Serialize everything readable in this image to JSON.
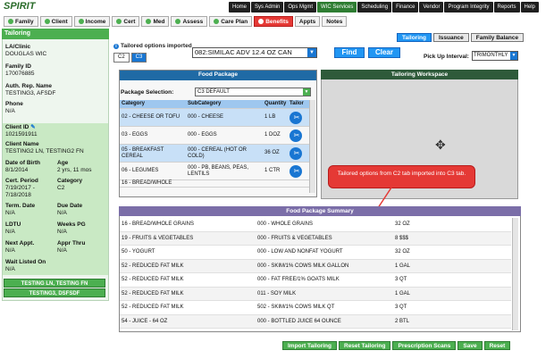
{
  "app": {
    "logo_text": "SPIRIT"
  },
  "top_menu": [
    "Home",
    "Sys Admin",
    "Ops Mgmt",
    "WIC Services",
    "Scheduling",
    "Finance",
    "Vendor",
    "Program Integrity",
    "Reports",
    "Help"
  ],
  "top_menu_active": "WIC Services",
  "module_tabs": [
    "Family",
    "Client",
    "Income",
    "Cert",
    "Med",
    "Assess",
    "Care Plan",
    "Benefits",
    "Appts",
    "Notes"
  ],
  "sidebar": {
    "header": "Tailoring",
    "la_clinic_label": "LA/Clinic",
    "la_clinic": "DOUGLAS WIC",
    "family_id_label": "Family ID",
    "family_id": "170076885",
    "auth_rep_label": "Auth. Rep. Name",
    "auth_rep": "TESTING3, AFSDF",
    "phone_label": "Phone",
    "phone": "N/A",
    "client_id_label": "Client ID",
    "client_id": "1021591911",
    "client_name_label": "Client Name",
    "client_name": "TESTING2 LN, TESTING2 FN",
    "dob_label": "Date of Birth",
    "dob": "8/1/2014",
    "age_label": "Age",
    "age": "2 yrs, 11 mos",
    "cert_period_label": "Cert. Period",
    "cert_period": "7/19/2017 - 7/18/2018",
    "category_label": "Category",
    "category": "C2",
    "term_date_label": "Term. Date",
    "term_date": "N/A",
    "due_date_label": "Due Date",
    "due_date": "N/A",
    "ldtu_label": "LDTU",
    "ldtu": "N/A",
    "weeks_pg_label": "Weeks PG",
    "weeks_pg": "N/A",
    "next_appt_label": "Next Appt.",
    "next_appt": "N/A",
    "appr_thru_label": "Appr Thru",
    "appr_thru": "N/A",
    "wait_listed_label": "Wait Listed On",
    "wait_listed": "N/A",
    "btn1": "TESTING LN, TESTING FN",
    "btn2": "TESTING3, DSFSDF"
  },
  "right_tabs": [
    "Tailoring",
    "Issuance",
    "Family Balance"
  ],
  "tailoring": {
    "info_text": "Tailored options imported",
    "c_tabs": [
      "C2",
      "C3"
    ],
    "search_value": "082:SIMILAC ADV 12.4 OZ CAN",
    "find_label": "Find",
    "clear_label": "Clear",
    "pickup_label": "Pick Up Interval:",
    "pickup_value": "TRIMONTHLY"
  },
  "food_package": {
    "title": "Food Package",
    "selection_label": "Package Selection:",
    "selection_value": "C3 DEFAULT",
    "columns": [
      "Category",
      "SubCategory",
      "Quantity",
      "Tailor"
    ],
    "rows": [
      [
        "02 - CHEESE OR TOFU",
        "000 - CHEESE",
        "1 LB"
      ],
      [
        "03 - EGGS",
        "000 - EGGS",
        "1 DOZ"
      ],
      [
        "05 - BREAKFAST CEREAL",
        "000 - CEREAL (HOT OR COLD)",
        "36 OZ"
      ],
      [
        "06 - LEGUMES",
        "000 - PB, BEANS, PEAS, LENTILS",
        "1 CTR"
      ],
      [
        "16 - BREAD/WHOLE",
        "",
        ""
      ]
    ]
  },
  "workspace": {
    "title": "Tailoring Workspace"
  },
  "callout": {
    "text": "Tailored options from C2 tab imported into C3 tab."
  },
  "summary": {
    "title": "Food Package Summary",
    "rows": [
      [
        "16 - BREAD/WHOLE GRAINS",
        "000 - WHOLE GRAINS",
        "32 OZ"
      ],
      [
        "19 - FRUITS & VEGETABLES",
        "000 - FRUITS & VEGETABLES",
        "8 $$$"
      ],
      [
        "50 - YOGURT",
        "000 - LOW AND NONFAT YOGURT",
        "32 OZ"
      ],
      [
        "52 - REDUCED FAT MILK",
        "000 - SKIM/1% COWS MILK GALLON",
        "1 GAL"
      ],
      [
        "52 - REDUCED FAT MILK",
        "000 - FAT FREE/1% GOATS MILK",
        "3 QT"
      ],
      [
        "52 - REDUCED FAT MILK",
        "011 - SOY MILK",
        "1 GAL"
      ],
      [
        "52 - REDUCED FAT MILK",
        "502 - SKIM/1% COWS MILK QT",
        "3 QT"
      ],
      [
        "54 - JUICE - 64 OZ",
        "000 - BOTTLED JUICE 64 OUNCE",
        "2 BTL"
      ]
    ]
  },
  "bottom_buttons": [
    "Import Tailoring",
    "Reset Tailoring",
    "Prescription Scans",
    "Save",
    "Reset"
  ]
}
